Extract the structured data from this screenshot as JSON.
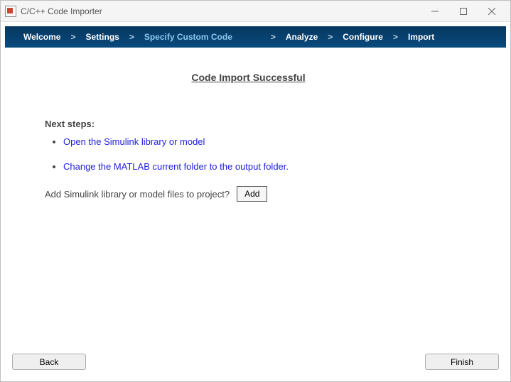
{
  "window": {
    "title": "C/C++ Code Importer"
  },
  "wizard": {
    "steps": [
      "Welcome",
      "Settings",
      "Specify Custom Code",
      "Analyze",
      "Configure",
      "Import"
    ],
    "active_index": 2
  },
  "main": {
    "success_heading": "Code Import Successful",
    "next_steps_label": "Next steps:",
    "links": [
      "Open the Simulink library or model",
      "Change the MATLAB current folder to the output folder."
    ],
    "add_prompt": "Add Simulink library or model files to project?",
    "add_button": "Add"
  },
  "footer": {
    "back": "Back",
    "finish": "Finish"
  }
}
